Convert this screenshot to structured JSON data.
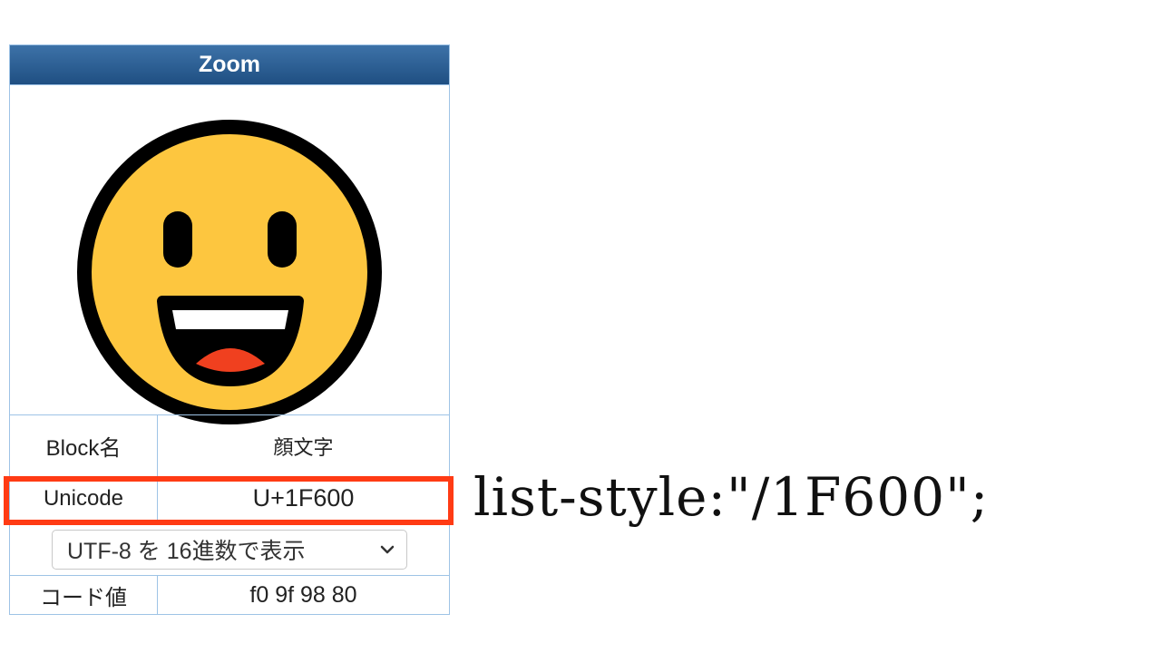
{
  "panel": {
    "title": "Zoom"
  },
  "emoji": {
    "name": "grinning-face",
    "colors": {
      "face": "#fdc63f",
      "outline": "#000000",
      "teeth": "#ffffff",
      "tongue": "#f0401f"
    }
  },
  "rows": {
    "block": {
      "label": "Block名",
      "value": "顔文字"
    },
    "unicode": {
      "label": "Unicode",
      "value": "U+1F600"
    },
    "encoding_select": {
      "selected": "UTF-8 を 16進数で表示"
    },
    "code": {
      "label": "コード値",
      "value": "f0 9f 98 80"
    }
  },
  "annotation": {
    "css_text": "list-style:\"/1F600\";",
    "highlight_color": "#ff3b14"
  },
  "colors": {
    "header_bg": "#2a5d91",
    "border": "#9ec3e6"
  }
}
